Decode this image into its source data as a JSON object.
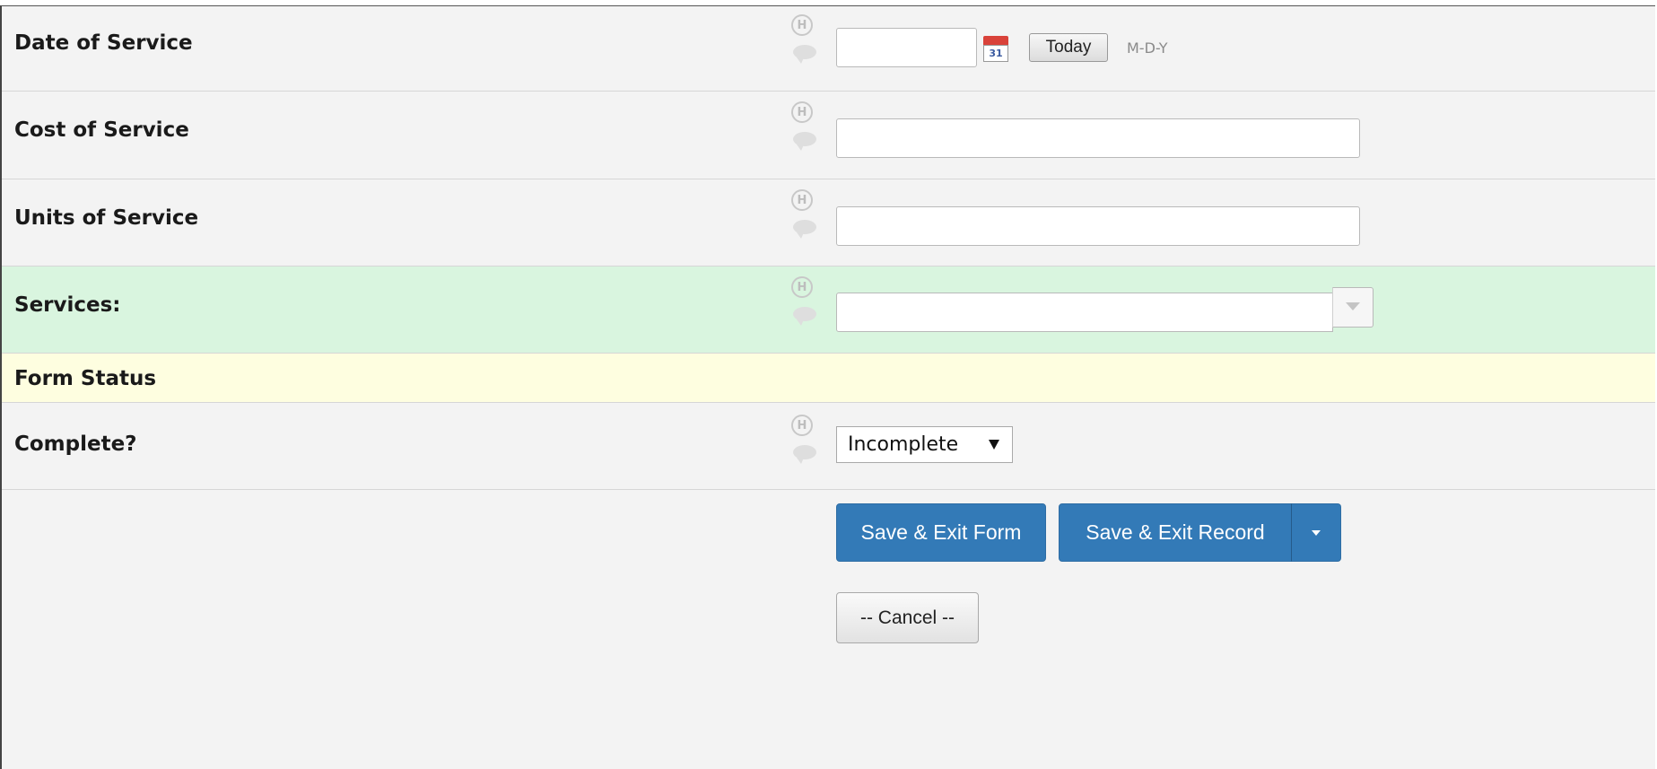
{
  "form": {
    "fields": [
      {
        "label": "Date of Service",
        "value": ""
      },
      {
        "label": "Cost of Service",
        "value": ""
      },
      {
        "label": "Units of Service",
        "value": ""
      },
      {
        "label": "Services:",
        "value": ""
      }
    ],
    "date_field": {
      "today_label": "Today",
      "format_hint": "M-D-Y",
      "calendar_day": "31"
    },
    "history_icon_glyph": "H",
    "status_section": {
      "title": "Form Status",
      "complete_label": "Complete?",
      "complete_value": "Incomplete"
    },
    "actions": {
      "save_exit_form": "Save & Exit Form",
      "save_exit_record": "Save & Exit Record",
      "cancel": "-- Cancel --"
    }
  },
  "colors": {
    "primary_button": "#337ab7",
    "highlight_row": "#d9f5df",
    "section_header": "#fefee0"
  }
}
